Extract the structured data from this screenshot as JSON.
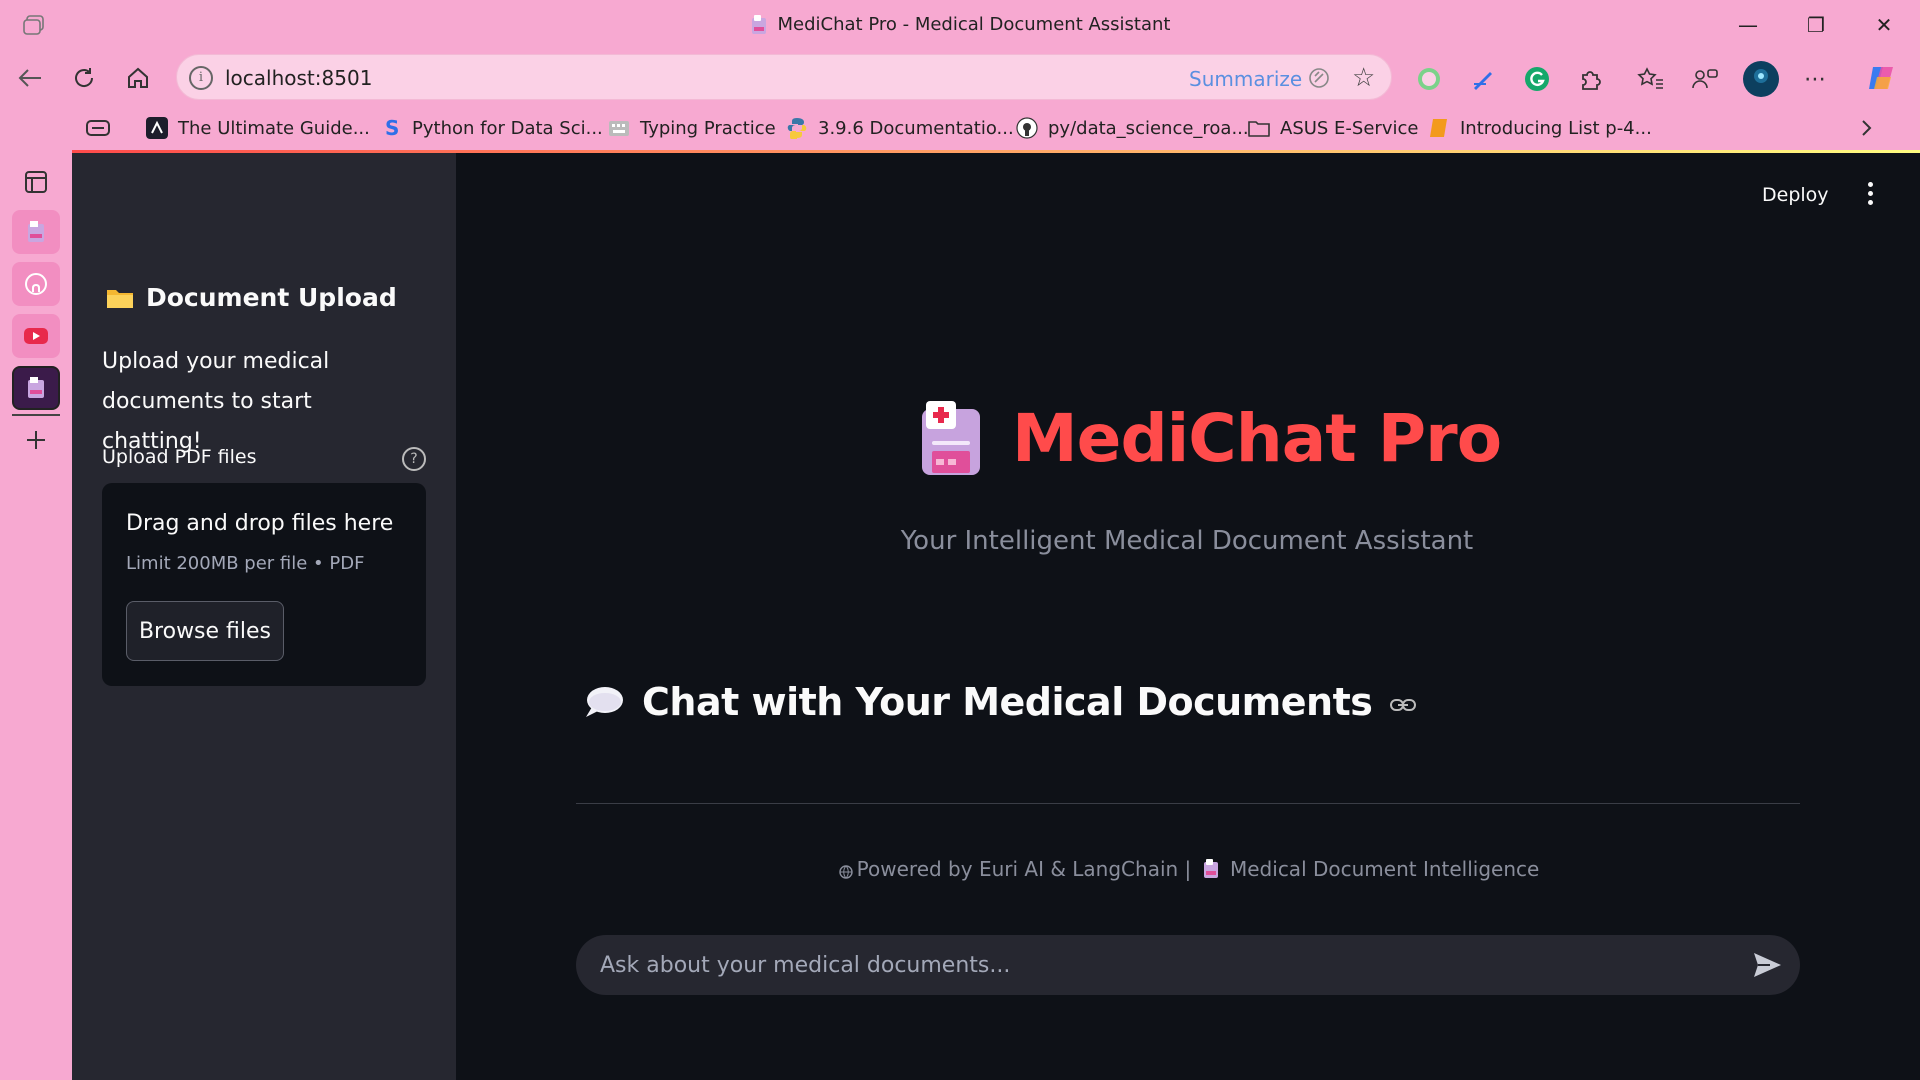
{
  "window": {
    "title": "MediChat Pro - Medical Document Assistant",
    "controls": {
      "minimize": "—",
      "restore": "❐",
      "close": "✕"
    }
  },
  "navbar": {
    "url": "localhost:8501",
    "info_glyph": "i",
    "summarize_label": "Summarize",
    "more_glyph": "⋯"
  },
  "bookmarks": [
    {
      "label": "The Ultimate Guide...",
      "icon": "logo-icon"
    },
    {
      "label": "Python for Data Sci...",
      "icon": "s-icon"
    },
    {
      "label": "Typing Practice",
      "icon": "typing-icon"
    },
    {
      "label": "3.9.6 Documentatio...",
      "icon": "python-icon"
    },
    {
      "label": "py/data_science_roa...",
      "icon": "github-icon"
    },
    {
      "label": "ASUS E-Service",
      "icon": "folder-icon"
    },
    {
      "label": "Introducing List p-4...",
      "icon": "bookmark-icon"
    }
  ],
  "sidebar": {
    "title": "Document Upload",
    "description": "Upload your medical documents to start chatting!",
    "upload_label": "Upload PDF files",
    "help_glyph": "?",
    "dropzone": {
      "title": "Drag and drop files here",
      "subtitle": "Limit 200MB per file • PDF",
      "button_label": "Browse files"
    }
  },
  "header": {
    "deploy_label": "Deploy"
  },
  "main": {
    "title": "MediChat Pro",
    "subtitle": "Your Intelligent Medical Document Assistant",
    "chat_heading": "Chat with Your Medical Documents",
    "footer_left": "Powered by Euri AI & LangChain |",
    "footer_right": "Medical Document Intelligence",
    "chat_placeholder": "Ask about your medical documents..."
  },
  "colors": {
    "browser_chrome": "#f7a9d1",
    "app_background": "#0e1117",
    "sidebar_background": "#262730",
    "accent_red": "#ff4b4b",
    "text_primary": "#fafafa",
    "text_muted": "#8a8e9c"
  }
}
